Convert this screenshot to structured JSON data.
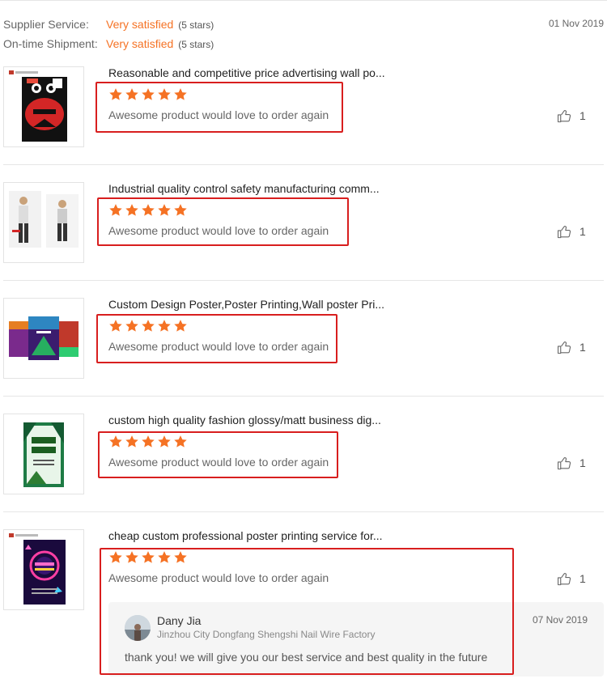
{
  "summary": {
    "supplier_service_label": "Supplier Service:",
    "supplier_service_value": "Very satisfied",
    "supplier_service_stars": "(5 stars)",
    "ontime_label": "On-time Shipment:",
    "ontime_value": "Very satisfied",
    "ontime_stars": "(5 stars)",
    "date": "01 Nov 2019"
  },
  "reviews": [
    {
      "title": "Reasonable and competitive price advertising wall po...",
      "rating": 5,
      "comment": "Awesome product would love to order again",
      "likes": "1",
      "image": "friday-poster"
    },
    {
      "title": "Industrial quality control safety manufacturing comm...",
      "rating": 5,
      "comment": "Awesome product would love to order again",
      "likes": "1",
      "image": "fashion-poster"
    },
    {
      "title": "Custom Design Poster,Poster Printing,Wall poster Pri...",
      "rating": 5,
      "comment": "Awesome product would love to order again",
      "likes": "1",
      "image": "sound-posters"
    },
    {
      "title": "custom high quality fashion glossy/matt business dig...",
      "rating": 5,
      "comment": "Awesome product would love to order again",
      "likes": "1",
      "image": "green-poster"
    },
    {
      "title": "cheap custom professional poster printing service for...",
      "rating": 5,
      "comment": "Awesome product would love to order again",
      "likes": "1",
      "image": "neon-friday-poster"
    }
  ],
  "reply": {
    "name": "Dany Jia",
    "company": "Jinzhou City Dongfang Shengshi Nail Wire Factory",
    "date": "07 Nov 2019",
    "text": "thank you! we will give you our best service and best quality in the future"
  },
  "colors": {
    "accent": "#f57224",
    "highlight_box": "#d81e1e"
  },
  "icons": {
    "like": "thumbs-up-icon",
    "star": "star-icon"
  }
}
